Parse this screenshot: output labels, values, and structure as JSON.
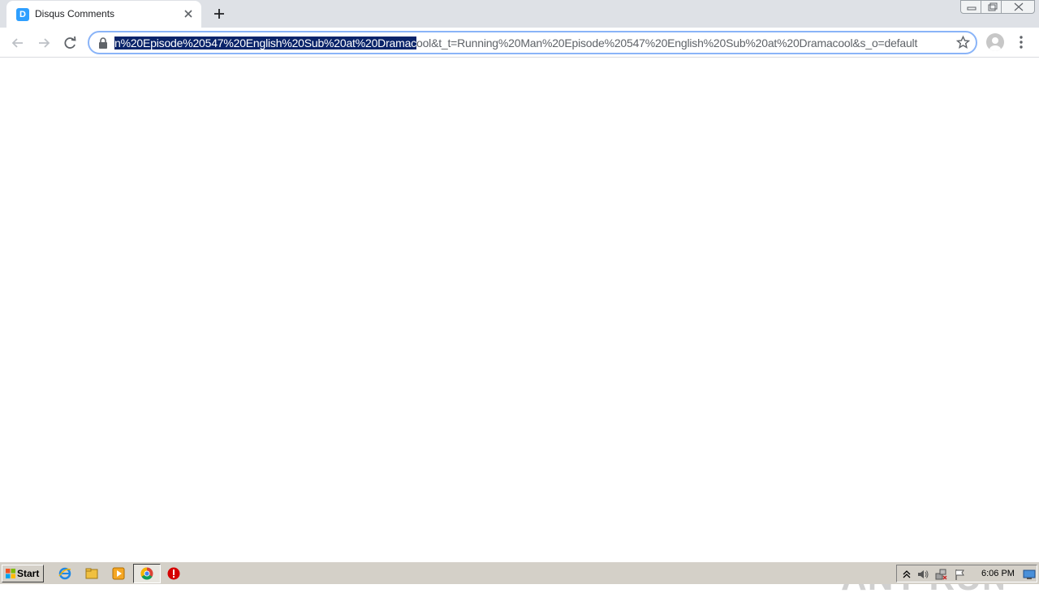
{
  "browser": {
    "tab": {
      "title": "Disqus Comments",
      "favicon_letter": "D",
      "favicon_color": "#2e9fff"
    },
    "address_bar": {
      "selected_text": "n%20Episode%20547%20English%20Sub%20at%20Dramac",
      "rest_text": "ool&t_t=Running%20Man%20Episode%20547%20English%20Sub%20at%20Dramacool&s_o=default",
      "selection_color": "#0a246a"
    }
  },
  "page": {
    "watermark": "ANY RUN"
  },
  "taskbar": {
    "start_label": "Start",
    "clock": "6:06 PM",
    "pinned": [
      "internet-explorer-icon",
      "folder-icon",
      "media-player-icon",
      "chrome-icon",
      "stop-icon"
    ]
  }
}
